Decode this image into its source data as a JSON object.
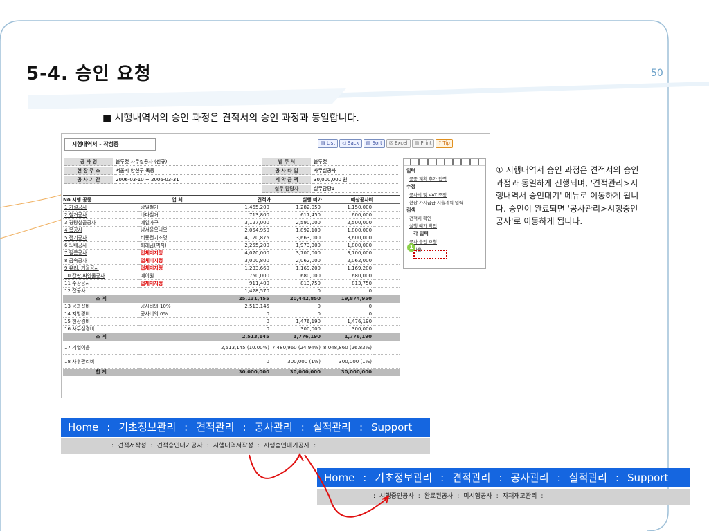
{
  "slide": {
    "title": "5-4. 승인 요청",
    "page_number": "50",
    "intro": "■ 시행내역서의 승인 과정은 견적서의 승인 과정과 동일합니다."
  },
  "window": {
    "title": "| 시행내역서 - 작성중"
  },
  "toolbar": {
    "buttons": [
      "▤ List",
      "◁ Back",
      "▤ Sort",
      "✉ Excel",
      "▤ Print",
      "? Tip"
    ]
  },
  "info": {
    "rows": [
      [
        "공 사 명",
        "블루컷 사무실공사 (신규)",
        "발 주 처",
        "블루컷"
      ],
      [
        "현 장 주 소",
        "서울시 양천구 목동",
        "공 사 타 입",
        "사무실공사"
      ],
      [
        "공 사 기 간",
        "2006-03-10 ~ 2006-03-31",
        "계 약 금 액",
        "30,000,000 원"
      ],
      [
        "",
        "",
        "실무 담당자",
        "실무담당1"
      ]
    ]
  },
  "grid": {
    "headers": [
      "No   시행 공종",
      "업 체",
      "견적가",
      "실행 예가",
      "예상공사비"
    ],
    "rows": [
      {
        "c": [
          "1 가설공사",
          "광일철거",
          "1,465,200",
          "1,282,050",
          "1,150,000"
        ],
        "u": true
      },
      {
        "c": [
          "2 철거공사",
          "바다철거",
          "713,800",
          "617,450",
          "600,000"
        ],
        "u": true
      },
      {
        "c": [
          "3 경량칠골공사",
          "예일가구",
          "3,127,000",
          "2,590,000",
          "2,500,000"
        ],
        "u": true
      },
      {
        "c": [
          "4 목공사",
          "남서울목닉목",
          "2,054,950",
          "1,892,100",
          "1,800,000"
        ],
        "u": true
      },
      {
        "c": [
          "5 전기공사",
          "비룡전기조명",
          "4,120,875",
          "3,663,000",
          "3,600,000"
        ],
        "u": true
      },
      {
        "c": [
          "6 도배공사",
          "희래금(벽지)",
          "2,255,200",
          "1,973,300",
          "1,800,000"
        ],
        "u": true
      },
      {
        "c": [
          "7 필름공사",
          "업체미지정",
          "4,070,000",
          "3,700,000",
          "3,700,000"
        ],
        "u": true,
        "red": true
      },
      {
        "c": [
          "8 금속공사",
          "업체미지정",
          "3,000,800",
          "2,062,000",
          "2,062,000"
        ],
        "u": true,
        "red": true
      },
      {
        "c": [
          "9 유리, 거울공사",
          "업체미지정",
          "1,233,660",
          "1,169,200",
          "1,169,200"
        ],
        "u": true,
        "red": true
      },
      {
        "c": [
          "10 간판,싸인물공사",
          "에이원",
          "750,000",
          "680,000",
          "680,000"
        ],
        "u": true
      },
      {
        "c": [
          "11 수장공사",
          "업체미지정",
          "911,400",
          "813,750",
          "813,750"
        ],
        "u": true,
        "red": true
      },
      {
        "c": [
          "12 잡공사",
          "",
          "1,428,570",
          "0",
          "0"
        ]
      },
      {
        "c": [
          "소 계",
          "",
          "25,131,455",
          "20,442,850",
          "19,874,950"
        ],
        "sub": true
      },
      {
        "c": [
          "13 공과잡비",
          "공사비의 10%",
          "2,513,145",
          "0",
          "0"
        ]
      },
      {
        "c": [
          "14 지방경비",
          "공사비의 0%",
          "0",
          "0",
          "0"
        ]
      },
      {
        "c": [
          "15 현장경비",
          "",
          "0",
          "1,476,190",
          "1,476,190"
        ]
      },
      {
        "c": [
          "16 사무실경비",
          "",
          "0",
          "300,000",
          "300,000"
        ]
      },
      {
        "c": [
          "소 계",
          "",
          "2,513,145",
          "1,776,190",
          "1,776,190"
        ],
        "sub": true
      },
      {
        "c": [
          "17 기업이윤",
          "",
          "2,513,145 (10.00%)",
          "7,480,960 (24.94%)",
          "8,048,860 (26.83%)"
        ],
        "tall": true
      },
      {
        "c": [
          "18 사후관리비",
          "",
          "0",
          "300,000 (1%)",
          "300,000 (1%)"
        ],
        "tall": true
      },
      {
        "c": [
          "합 계",
          "",
          "30,000,000",
          "30,000,000",
          "30,000,000"
        ],
        "sub": true
      }
    ]
  },
  "sidebar": {
    "sections": [
      {
        "title": "입력",
        "items": [
          "공종 계획 추가 입력"
        ]
      },
      {
        "title": "수정",
        "items": [
          "공사비 및 VAT 조정",
          "현장 가지급금 지출계획 입력"
        ]
      },
      {
        "title": "검색",
        "items": [
          "견적서 확인",
          "실행 예가 확인"
        ]
      },
      {
        "title": "각 입력",
        "items": [
          "공사 승인 요청",
          "미사용"
        ]
      }
    ],
    "marker": "1"
  },
  "description": "① 시행내역서 승인 과정은 견적서의 승인과정과 동일하게 진행되며, '견적관리>시행내역서 승인대기' 메뉴로 이동하게 됩니다. 승인이 완료되면 '공사관리>시행중인공사'로 이동하게 됩니다.",
  "nav1": {
    "items": [
      "Home",
      ":",
      "기초정보관리",
      ":",
      "견적관리",
      ":",
      "공사관리",
      ":",
      "실적관리",
      ":",
      "Support"
    ]
  },
  "sub1": {
    "items": [
      ":",
      "견적서작성",
      ":",
      "견적승인대기공사",
      ":",
      "시행내역서작성",
      ":",
      "시행승인대기공사",
      ":"
    ]
  },
  "nav2": {
    "items": [
      "Home",
      ":",
      "기초정보관리",
      ":",
      "견적관리",
      ":",
      "공사관리",
      ":",
      "실적관리",
      ":",
      "Support"
    ]
  },
  "sub2": {
    "items": [
      ":",
      "시행중인공사",
      ":",
      "완료된공사",
      ":",
      "미시행공사",
      ":",
      "자재재고관리",
      ":"
    ]
  },
  "colors": {
    "nav": "#1566e0",
    "accent_red": "#dd0000",
    "marker": "#8cd14a"
  }
}
